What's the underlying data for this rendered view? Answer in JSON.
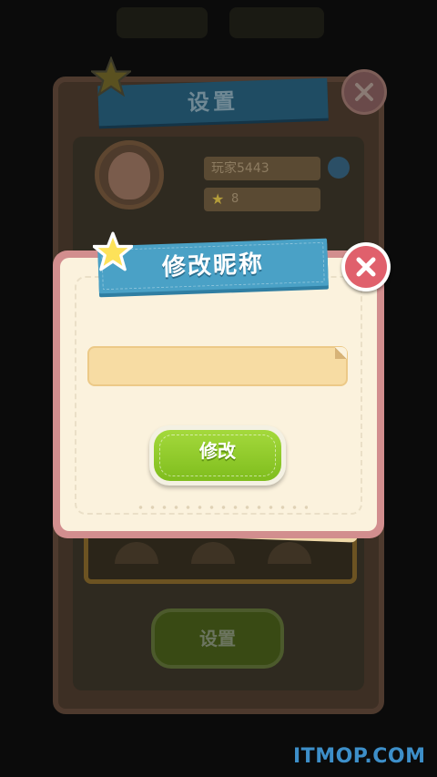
{
  "background_screen": {
    "title": "设置",
    "player_name": "玩家5443",
    "level": "8",
    "button_label": "设置"
  },
  "dialog": {
    "title": "修改昵称",
    "nickname_input": {
      "value": "",
      "placeholder": ""
    },
    "confirm_label": "修改",
    "close_icon": "close-icon",
    "star_icon": "star-icon"
  },
  "watermark": "ITMOP.COM",
  "colors": {
    "ribbon": "#4aa1c6",
    "confirm": "#8cc82a",
    "close": "#e0606c",
    "panel": "#fbf2dd",
    "frame": "#d28e8e"
  }
}
